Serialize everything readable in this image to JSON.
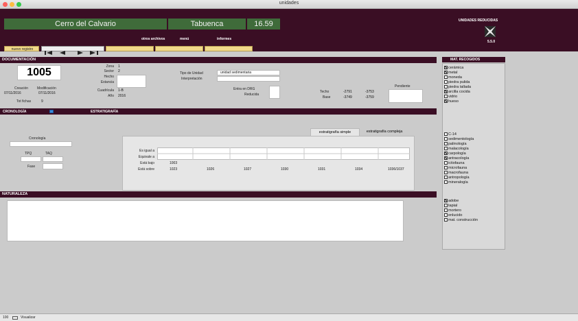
{
  "window": {
    "title": "unidades"
  },
  "header": {
    "site": "Cerro del Calvario",
    "place": "Tabuenca",
    "version": "16.59",
    "nav": {
      "otros_archivos": "otros archivos",
      "menu": "menú",
      "informes": "informes"
    },
    "new_record": "nuevo registro",
    "right_title": "UNIDADES REDUCIDAS",
    "right_version": "5.5.0"
  },
  "documentation": {
    "section_label": "DOCUMENTACIÓN",
    "unit_number": "1005",
    "creation_label": "Creación",
    "modification_label": "Modificación",
    "creation_date": "07/11/2016",
    "modification_date": "07/11/2016",
    "total_label": "Tot fichas",
    "total_value": "9",
    "fields": {
      "zona_label": "Zona",
      "zona": "1",
      "sector_label": "Sector",
      "sector": "2",
      "hecho_label": "Hecho",
      "hecho": "",
      "estancia_label": "Estancia",
      "estancia": "",
      "cuadricula_label": "Cuadrícula",
      "cuadricula": "1-B",
      "ano_label": "Año",
      "ano": "2016"
    },
    "tipo_label": "Tipo de Unidad",
    "tipo_value": "unidad sedimentaria",
    "interpretacion_label": "Interpretación",
    "interpretacion_value": "",
    "entra_label": "Entra en DRG",
    "reducida_label": "Reducida",
    "techo_label": "Techo",
    "techo_1": "-2791",
    "techo_2": "-3753",
    "base_label": "Base",
    "base_1": "-3749",
    "base_2": "-3759",
    "pendiente_label": "Pendiente"
  },
  "cronologia": {
    "section_label": "CRONOLOGÍA",
    "label": "Cronología",
    "tpq": "TPQ",
    "taq": "TAQ",
    "fase": "Fase"
  },
  "estratigrafia": {
    "section_label": "ESTRATIGRAFÍA",
    "tab_simple": "estratigrafía simple",
    "tab_compleja": "estratigrafía compleja",
    "row_labels": [
      "Es igual a",
      "Equivale a",
      "Está bajo",
      "Está sobre"
    ],
    "bajo": [
      "1003",
      "",
      "",
      "",
      "",
      "",
      ""
    ],
    "sobre": [
      "1023",
      "1026",
      "1027",
      "1030",
      "1031",
      "1034",
      "1036/1037"
    ]
  },
  "naturaleza": {
    "section_label": "NATURALEZA"
  },
  "materiales": {
    "title": "MAT. RECOGIDOS",
    "group1": [
      {
        "label": "cerámica",
        "checked": true
      },
      {
        "label": "metal",
        "checked": true
      },
      {
        "label": "moneda",
        "checked": false
      },
      {
        "label": "piedra pulida",
        "checked": false
      },
      {
        "label": "piedra tallada",
        "checked": false
      },
      {
        "label": "arcilla cocida",
        "checked": true
      },
      {
        "label": "vidrio",
        "checked": false
      },
      {
        "label": "hueso",
        "checked": true
      }
    ],
    "group2": [
      {
        "label": "C-14",
        "checked": false
      },
      {
        "label": "sedimentología",
        "checked": false
      },
      {
        "label": "palinología",
        "checked": false
      },
      {
        "label": "malacología",
        "checked": false
      },
      {
        "label": "carpología",
        "checked": true
      },
      {
        "label": "antracología",
        "checked": true
      },
      {
        "label": "ictiofauna",
        "checked": false
      },
      {
        "label": "microfauna",
        "checked": false
      },
      {
        "label": "macrofauna",
        "checked": false
      },
      {
        "label": "antropología",
        "checked": false
      },
      {
        "label": "mineralogía",
        "checked": false
      }
    ],
    "group3": [
      {
        "label": "adobe",
        "checked": true
      },
      {
        "label": "tapial",
        "checked": false
      },
      {
        "label": "mortero",
        "checked": false
      },
      {
        "label": "enlucido",
        "checked": false
      },
      {
        "label": "mat. construcción",
        "checked": false
      }
    ]
  },
  "status": {
    "zoom": "100",
    "mode": "Visualizar"
  }
}
